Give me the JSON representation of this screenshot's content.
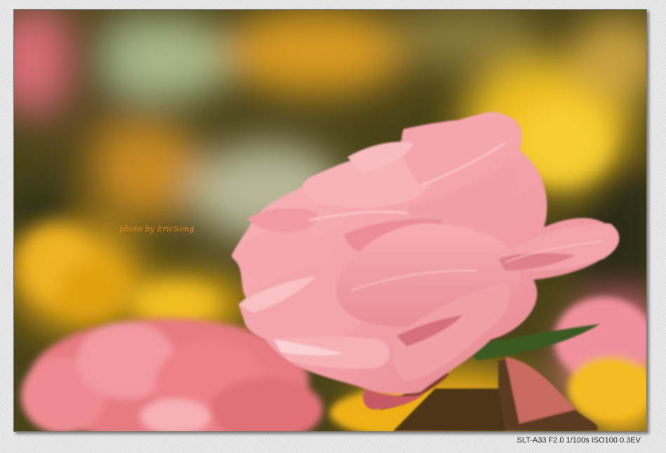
{
  "photo": {
    "subject": "pink-rose",
    "watermark": "photo by EricSong"
  },
  "caption": {
    "exif": "SLT-A33 F2.0 1/100s ISO100 0.3EV"
  },
  "colors": {
    "petal": "#f3a3a8",
    "petal_shadow": "#d9707c",
    "background_yellow": "#e9b21a",
    "background_dark": "#3b3a16",
    "watermark": "#e08a2a"
  }
}
